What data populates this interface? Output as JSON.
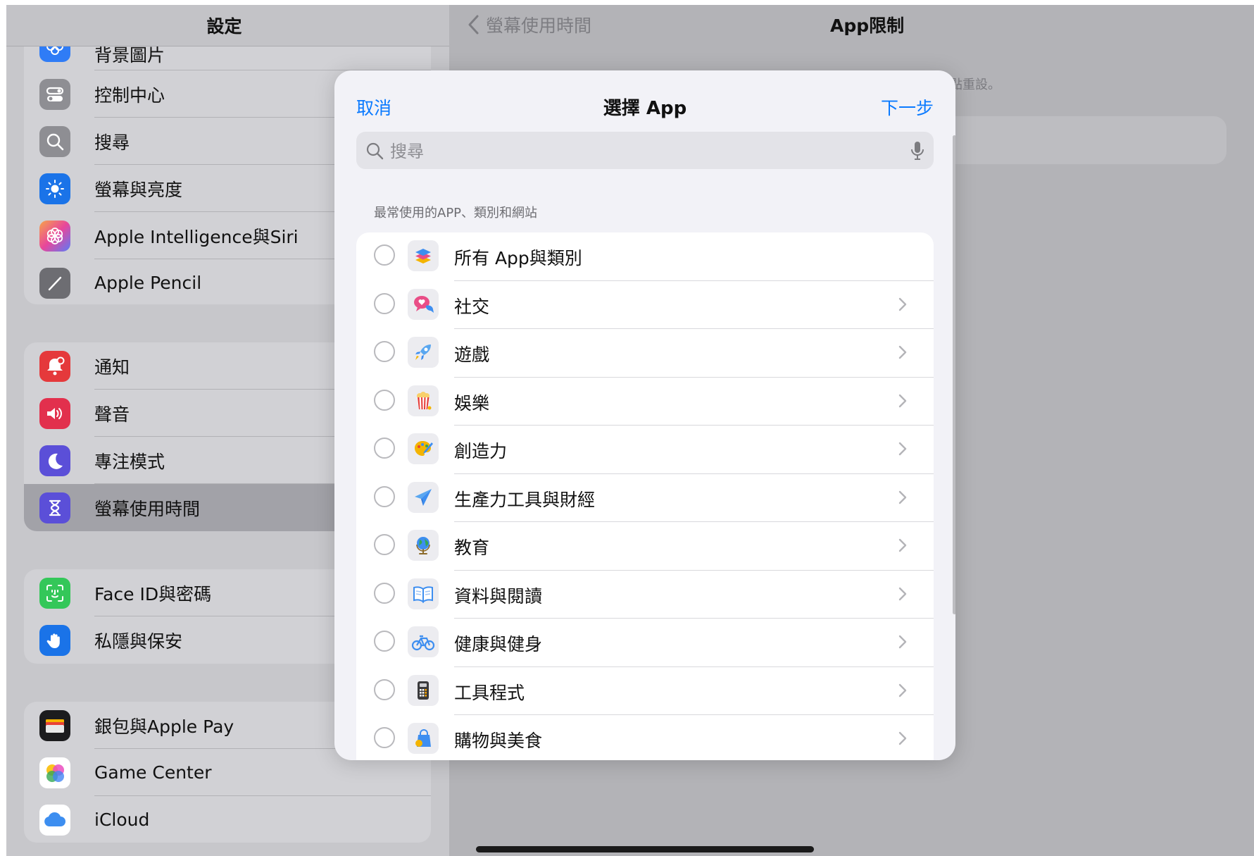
{
  "sidebar": {
    "title": "設定",
    "groups": [
      {
        "items": [
          {
            "label": "背景圖片",
            "icon": "wallpaper-icon"
          },
          {
            "label": "控制中心",
            "icon": "control-center-icon"
          },
          {
            "label": "搜尋",
            "icon": "search-icon"
          },
          {
            "label": "螢幕與亮度",
            "icon": "brightness-icon"
          },
          {
            "label": "Apple Intelligence與Siri",
            "icon": "apple-intelligence-icon"
          },
          {
            "label": "Apple Pencil",
            "icon": "pencil-icon"
          }
        ]
      },
      {
        "items": [
          {
            "label": "通知",
            "icon": "notification-bell-icon"
          },
          {
            "label": "聲音",
            "icon": "speaker-icon"
          },
          {
            "label": "專注模式",
            "icon": "moon-icon"
          },
          {
            "label": "螢幕使用時間",
            "icon": "hourglass-icon",
            "selected": true
          }
        ]
      },
      {
        "items": [
          {
            "label": "Face ID與密碼",
            "icon": "face-id-icon"
          },
          {
            "label": "私隱與保安",
            "icon": "hand-icon"
          }
        ]
      },
      {
        "items": [
          {
            "label": "銀包與Apple Pay",
            "icon": "wallet-icon"
          },
          {
            "label": "Game Center",
            "icon": "game-center-icon"
          },
          {
            "label": "iCloud",
            "icon": "icloud-icon"
          }
        ]
      }
    ]
  },
  "detail": {
    "back_label": "螢幕使用時間",
    "title": "App限制",
    "note_fragment": "點重設。"
  },
  "sheet": {
    "cancel_label": "取消",
    "title": "選擇 App",
    "next_label": "下一步",
    "search_placeholder": "搜尋",
    "section_header": "最常使用的APP、類別和網站",
    "items": [
      {
        "label": "所有 App與類別",
        "icon": "all-apps-stack-icon",
        "chevron": false
      },
      {
        "label": "社交",
        "icon": "social-chat-icon",
        "chevron": true
      },
      {
        "label": "遊戲",
        "icon": "rocket-icon",
        "chevron": true
      },
      {
        "label": "娛樂",
        "icon": "popcorn-icon",
        "chevron": true
      },
      {
        "label": "創造力",
        "icon": "palette-icon",
        "chevron": true
      },
      {
        "label": "生產力工具與財經",
        "icon": "paper-plane-icon",
        "chevron": true
      },
      {
        "label": "教育",
        "icon": "globe-icon",
        "chevron": true
      },
      {
        "label": "資料與閱讀",
        "icon": "book-icon",
        "chevron": true
      },
      {
        "label": "健康與健身",
        "icon": "bicycle-icon",
        "chevron": true
      },
      {
        "label": "工具程式",
        "icon": "calculator-icon",
        "chevron": true
      },
      {
        "label": "購物與美食",
        "icon": "shopping-bag-icon",
        "chevron": true
      }
    ]
  },
  "colors": {
    "accent": "#0a7aff"
  }
}
